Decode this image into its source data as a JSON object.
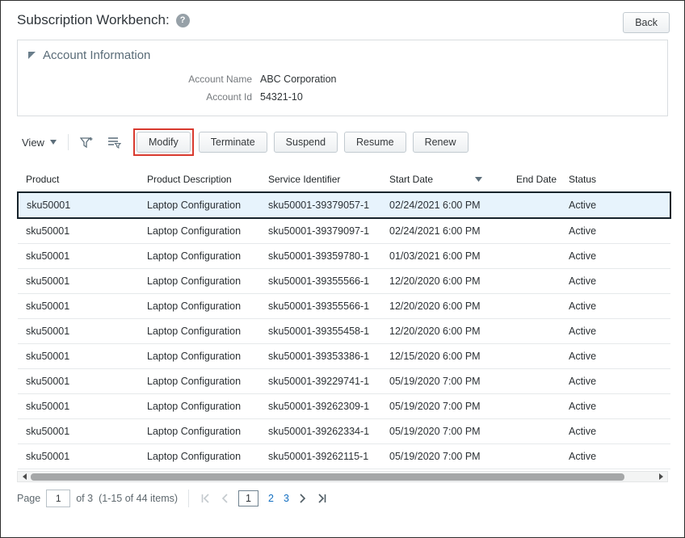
{
  "window": {
    "title": "Subscription Workbench:",
    "back_button": "Back"
  },
  "icons": {
    "help": "?"
  },
  "colors": {
    "callout_red": "#d93a2f",
    "link_blue": "#1470c2",
    "selected_row_background": "#e7f3fc"
  },
  "account": {
    "section_title": "Account Information",
    "name_label": "Account Name",
    "name_value": "ABC Corporation",
    "id_label": "Account Id",
    "id_value": "54321-10"
  },
  "toolbar": {
    "view_label": "View",
    "buttons": {
      "modify": "Modify",
      "terminate": "Terminate",
      "suspend": "Suspend",
      "resume": "Resume",
      "renew": "Renew"
    }
  },
  "table": {
    "columns": [
      "Product",
      "Product Description",
      "Service Identifier",
      "Start Date",
      "End Date",
      "Status"
    ],
    "sorted_column": "Start Date",
    "sort_direction": "descending",
    "selected_row_index": 0,
    "rows": [
      {
        "product": "sku50001",
        "description": "Laptop Configuration",
        "service_identifier": "sku50001-39379057-1",
        "start_date": "02/24/2021 6:00 PM",
        "end_date": "",
        "status": "Active"
      },
      {
        "product": "sku50001",
        "description": "Laptop Configuration",
        "service_identifier": "sku50001-39379097-1",
        "start_date": "02/24/2021 6:00 PM",
        "end_date": "",
        "status": "Active"
      },
      {
        "product": "sku50001",
        "description": "Laptop Configuration",
        "service_identifier": "sku50001-39359780-1",
        "start_date": "01/03/2021 6:00 PM",
        "end_date": "",
        "status": "Active"
      },
      {
        "product": "sku50001",
        "description": "Laptop Configuration",
        "service_identifier": "sku50001-39355566-1",
        "start_date": "12/20/2020 6:00 PM",
        "end_date": "",
        "status": "Active"
      },
      {
        "product": "sku50001",
        "description": "Laptop Configuration",
        "service_identifier": "sku50001-39355566-1",
        "start_date": "12/20/2020 6:00 PM",
        "end_date": "",
        "status": "Active"
      },
      {
        "product": "sku50001",
        "description": "Laptop Configuration",
        "service_identifier": "sku50001-39355458-1",
        "start_date": "12/20/2020 6:00 PM",
        "end_date": "",
        "status": "Active"
      },
      {
        "product": "sku50001",
        "description": "Laptop Configuration",
        "service_identifier": "sku50001-39353386-1",
        "start_date": "12/15/2020 6:00 PM",
        "end_date": "",
        "status": "Active"
      },
      {
        "product": "sku50001",
        "description": "Laptop Configuration",
        "service_identifier": "sku50001-39229741-1",
        "start_date": "05/19/2020 7:00 PM",
        "end_date": "",
        "status": "Active"
      },
      {
        "product": "sku50001",
        "description": "Laptop Configuration",
        "service_identifier": "sku50001-39262309-1",
        "start_date": "05/19/2020 7:00 PM",
        "end_date": "",
        "status": "Active"
      },
      {
        "product": "sku50001",
        "description": "Laptop Configuration",
        "service_identifier": "sku50001-39262334-1",
        "start_date": "05/19/2020 7:00 PM",
        "end_date": "",
        "status": "Active"
      },
      {
        "product": "sku50001",
        "description": "Laptop Configuration",
        "service_identifier": "sku50001-39262115-1",
        "start_date": "05/19/2020 7:00 PM",
        "end_date": "",
        "status": "Active"
      }
    ]
  },
  "pagination": {
    "page_label": "Page",
    "current_page": "1",
    "of_label": "of 3",
    "items_summary": "(1-15 of 44 items)",
    "pages": [
      "1",
      "2",
      "3"
    ]
  }
}
